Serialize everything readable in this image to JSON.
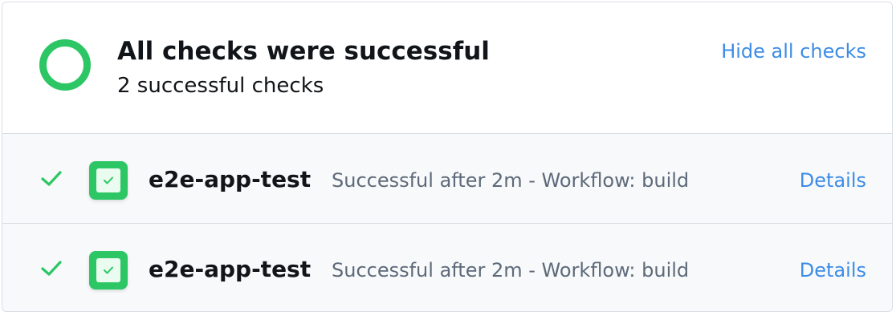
{
  "summary": {
    "title": "All checks were successful",
    "subtitle": "2 successful checks",
    "hide_link": "Hide all checks",
    "status_icon": "success-ring-icon",
    "status_color": "#2cc764"
  },
  "colors": {
    "success": "#2cc764",
    "link": "#3d8ce6",
    "muted_text": "#5e6a79",
    "row_background": "#f7f9fb",
    "border": "#d8dde3"
  },
  "checks": [
    {
      "name": "e2e-app-test",
      "description": "Successful after 2m - Workflow: build",
      "details_label": "Details",
      "status_icon": "checkmark-icon",
      "app_icon": "green-app-checkbox-icon"
    },
    {
      "name": "e2e-app-test",
      "description": "Successful after 2m - Workflow: build",
      "details_label": "Details",
      "status_icon": "checkmark-icon",
      "app_icon": "green-app-checkbox-icon"
    }
  ]
}
